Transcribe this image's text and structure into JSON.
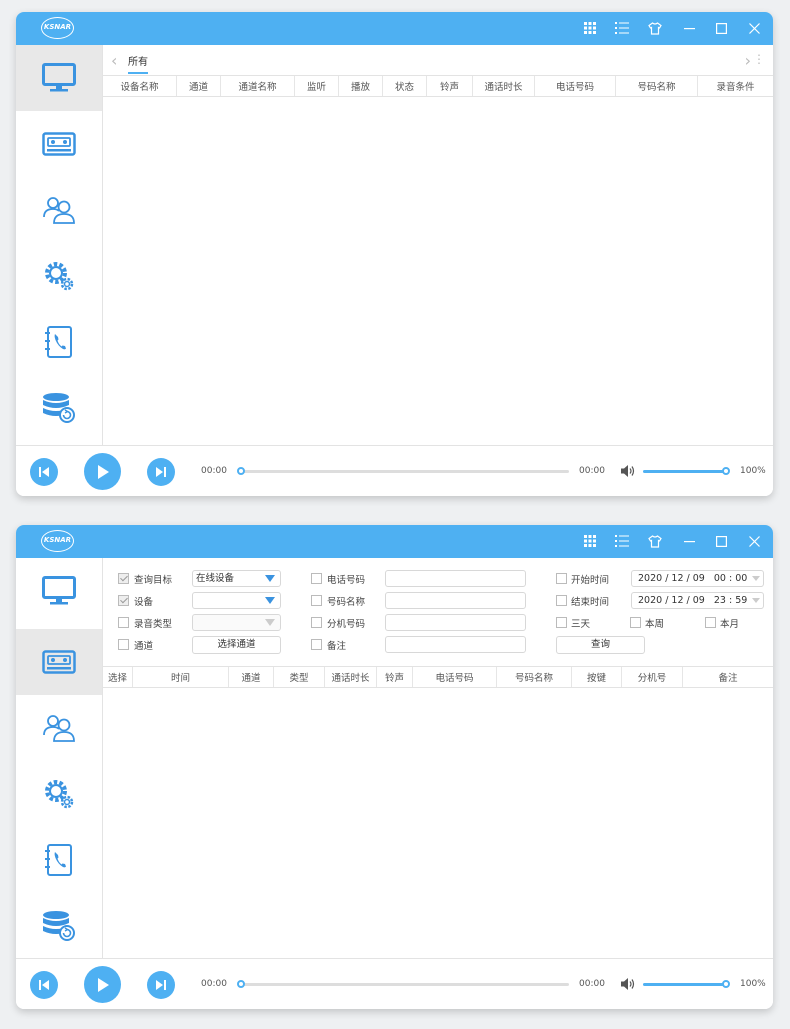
{
  "app": {
    "logo_text": "KSNAR",
    "colors": {
      "accent": "#4eb0f2",
      "sidebar_active": "#e8e8e8",
      "icon_blue": "#3a93e0"
    },
    "titlebar_icons": [
      "grid-icon",
      "list-icon",
      "skin-icon",
      "minimize-icon",
      "maximize-icon",
      "close-icon"
    ],
    "sidebar_icons": [
      "monitor-icon",
      "recorder-icon",
      "contacts-icon",
      "settings-icon",
      "phonebook-icon",
      "database-icon"
    ]
  },
  "window1": {
    "tab_all": "所有",
    "columns": [
      "设备名称",
      "通道",
      "通道名称",
      "监听",
      "播放",
      "状态",
      "铃声",
      "通话时长",
      "电话号码",
      "号码名称",
      "录音条件"
    ],
    "player": {
      "time_start": "00:00",
      "time_end": "00:00",
      "volume": "100%",
      "progress": 0,
      "volume_level": 1.0
    }
  },
  "window2": {
    "filters": {
      "query_target": {
        "label": "查询目标",
        "checked": true,
        "value": "在线设备"
      },
      "device": {
        "label": "设备",
        "checked": true,
        "value": ""
      },
      "record_type": {
        "label": "录音类型",
        "checked": false,
        "value": ""
      },
      "channel": {
        "label": "通道",
        "checked": false,
        "button": "选择通道"
      },
      "phone_number": {
        "label": "电话号码",
        "checked": false,
        "value": ""
      },
      "number_name": {
        "label": "号码名称",
        "checked": false,
        "value": ""
      },
      "extension": {
        "label": "分机号码",
        "checked": false,
        "value": ""
      },
      "remark": {
        "label": "备注",
        "checked": false,
        "value": ""
      },
      "start_time": {
        "label": "开始时间",
        "checked": false,
        "date": "2020 / 12 / 09",
        "time": "00 : 00"
      },
      "end_time": {
        "label": "结束时间",
        "checked": false,
        "date": "2020 / 12 / 09",
        "time": "23 : 59"
      },
      "three_days": {
        "label": "三天",
        "checked": false
      },
      "this_week": {
        "label": "本周",
        "checked": false
      },
      "this_month": {
        "label": "本月",
        "checked": false
      },
      "query_button": "查询"
    },
    "columns": [
      "选择",
      "时间",
      "通道",
      "类型",
      "通话时长",
      "铃声",
      "电话号码",
      "号码名称",
      "按键",
      "分机号",
      "备注"
    ],
    "player": {
      "time_start": "00:00",
      "time_end": "00:00",
      "volume": "100%",
      "progress": 0,
      "volume_level": 1.0
    }
  }
}
